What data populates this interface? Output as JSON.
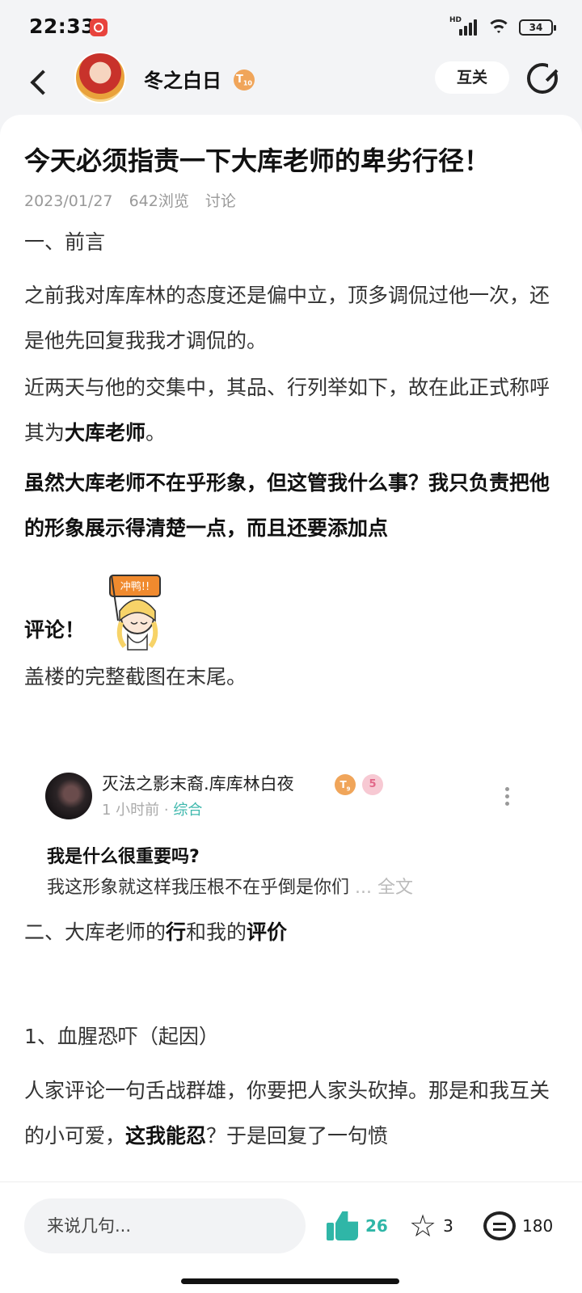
{
  "status": {
    "time": "22:33",
    "battery": "34",
    "network": "HD"
  },
  "header": {
    "username": "冬之白日",
    "level": "10",
    "follow_label": "互关"
  },
  "post": {
    "title": "今天必须指责一下大库老师的卑劣行径！",
    "date": "2023/01/27",
    "views": "642浏览",
    "category": "讨论",
    "section1": "一、前言",
    "p1": "之前我对库库林的态度还是偏中立，顶多调侃过他一次，还是他先回复我我才调侃的。",
    "p2_pre": "近两天与他的交集中，其品、行列举如下，故在此正式称呼其为",
    "p2_bold": "大库老师",
    "p2_post": "。",
    "p3": "虽然大库老师不在乎形象，但这管我什么事？我只负责把他的形象展示得清楚一点，而且还要添加点",
    "p3_tail": "评论！",
    "sticker_text": "冲鸭!!",
    "p4": "盖楼的完整截图在末尾。",
    "section2_a": "二、大库老师的",
    "section2_b": "行",
    "section2_c": "和我的",
    "section2_d": "评价",
    "sub1": "1、血腥恐吓（起因）",
    "p5_a": "人家评论一句舌战群雄，你要把人家头砍掉。那是和我互关的小可爱，",
    "p5_bold": "这我能忍",
    "p5_b": "？于是回复了一句愤"
  },
  "embed": {
    "name": "灭法之影末裔.库库林白夜",
    "level": "9",
    "badge2": "5",
    "time": "1 小时前 · ",
    "category": "综合",
    "question": "我是什么很重要吗?",
    "text": "我这形象就这样我压根不在乎倒是你们 ",
    "full": "... 全文"
  },
  "bottom": {
    "placeholder": "来说几句...",
    "likes": "26",
    "stars": "3",
    "comments": "180"
  },
  "colors": {
    "accent": "#2fb6a7",
    "badge": "#f0a55a",
    "category": "#3fb8ad"
  }
}
